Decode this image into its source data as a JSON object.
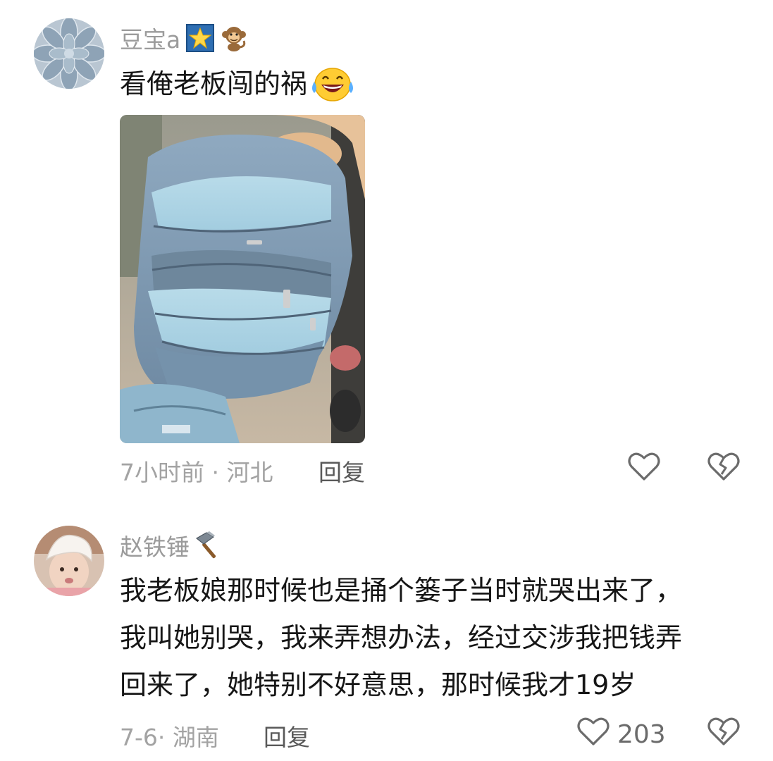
{
  "comments": [
    {
      "username": "豆宝a",
      "text_lines": [
        "看俺老板闯的祸"
      ],
      "time_location": "7小时前 · 河北",
      "reply_label": "回复",
      "like_count": ""
    },
    {
      "username": "赵铁锤",
      "text_lines": [
        "我老板娘那时候也是捅个篓子当时就哭出来了，",
        "我叫她别哭，我来弄想办法，经过交涉我把钱弄",
        "回来了，她特别不好意思，那时候我才19岁"
      ],
      "time_location": "7-6· 湖南",
      "reply_label": "回复",
      "like_count": "203"
    }
  ],
  "icons": {
    "star_badge": "star-badge-icon",
    "monkey": "monkey-emoji-icon",
    "laugh_cry": "laughing-crying-emoji-icon",
    "hammer": "hammer-icon",
    "heart": "heart-icon",
    "broken_heart": "broken-heart-icon"
  },
  "colors": {
    "meta_text": "#a3a3a3",
    "username_text": "#9b9b9b",
    "body_text": "#161616",
    "icon_stroke": "#6b6b6b"
  }
}
